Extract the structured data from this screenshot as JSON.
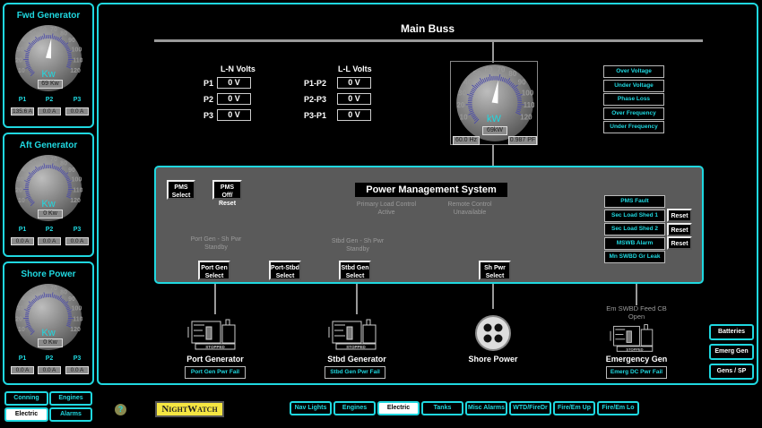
{
  "side_panels": [
    {
      "title": "Fwd Generator",
      "unit": "Kw",
      "reading": "69 Kw",
      "kw": 69,
      "phases": [
        "P1",
        "P2",
        "P3"
      ],
      "amps": [
        "135.6 A",
        "0.0 A",
        "0.0 A"
      ]
    },
    {
      "title": "Aft Generator",
      "unit": "Kw",
      "reading": "0 Kw",
      "kw": 0,
      "phases": [
        "P1",
        "P2",
        "P3"
      ],
      "amps": [
        "0.0 A",
        "0.0 A",
        "0.0 A"
      ]
    },
    {
      "title": "Shore Power",
      "unit": "Kw",
      "reading": "0 Kw",
      "kw": 0,
      "phases": [
        "P1",
        "P2",
        "P3"
      ],
      "amps": [
        "0.0 A",
        "0.0 A",
        "0.0 A"
      ]
    }
  ],
  "gauge_ticks": [
    "10",
    "20",
    "30",
    "40",
    "50",
    "60",
    "70",
    "80",
    "90",
    "100",
    "110",
    "120"
  ],
  "main": {
    "title": "Main Buss",
    "ln": {
      "header": "L-N Volts",
      "rows": [
        {
          "label": "P1",
          "value": "0 V"
        },
        {
          "label": "P2",
          "value": "0 V"
        },
        {
          "label": "P3",
          "value": "0 V"
        }
      ]
    },
    "ll": {
      "header": "L-L Volts",
      "rows": [
        {
          "label": "P1-P2",
          "value": "0 V"
        },
        {
          "label": "P2-P3",
          "value": "0 V"
        },
        {
          "label": "P3-P1",
          "value": "0 V"
        }
      ]
    },
    "buss_gauge": {
      "unit": "kW",
      "reading": "69kW",
      "kw": 69,
      "freq": "60.0 Hz",
      "pf": "0.987 PF"
    },
    "buss_alarms": [
      "Over Voltage",
      "Under Voltage",
      "Phase Loss",
      "Over Frequency",
      "Under Frequency"
    ],
    "pms": {
      "title": "Power Management System",
      "pms_select": "PMS Select",
      "pms_off": "PMS Off/ Reset",
      "primary_load": "Primary Load Control Active",
      "remote": "Remote Control Unavailable",
      "port_standby": "Port Gen - Sh Pwr Standby",
      "stbd_standby": "Stbd Gen - Sh Pwr Standby",
      "buttons": [
        "Port Gen Select",
        "Port-Stbd Select",
        "Stbd Gen Select",
        "Sh Pwr Select"
      ],
      "alarms": [
        "PMS Fault",
        "Sec Load Shed 1",
        "Sec Load Shed 2",
        "MSWB Alarm",
        "Mn SWBD Gr Leak"
      ],
      "reset": "Reset"
    },
    "devices": [
      {
        "name": "Port Generator",
        "status": "STOPPED",
        "alarm": "Port Gen Pwr Fail"
      },
      {
        "name": "Stbd Generator",
        "status": "STOPPED",
        "alarm": "Stbd Gen Pwr Fail"
      },
      {
        "name": "Shore Power"
      },
      {
        "name": "Emergency Gen",
        "status": "STOPPED",
        "alarm": "Emerg DC Pwr Fail",
        "note": "Em SWBD Feed CB Open"
      }
    ],
    "right_buttons": [
      "Batteries",
      "Emerg Gen",
      "Gens / SP"
    ]
  },
  "bottom": {
    "left_nav": [
      "Conning",
      "Engines",
      "Electric",
      "Alarms"
    ],
    "help": "?",
    "logo": "NightWatch",
    "tabs": [
      "Nav Lights",
      "Engines",
      "Electric",
      "Tanks",
      "Misc Alarms",
      "WTD/FireDr",
      "Fire/Em Up",
      "Fire/Em Lo"
    ],
    "active": "Electric"
  },
  "colors": {
    "accent": "#1fd8e0",
    "panel": "#5a5a5a",
    "logo_bg": "#f5e642"
  }
}
